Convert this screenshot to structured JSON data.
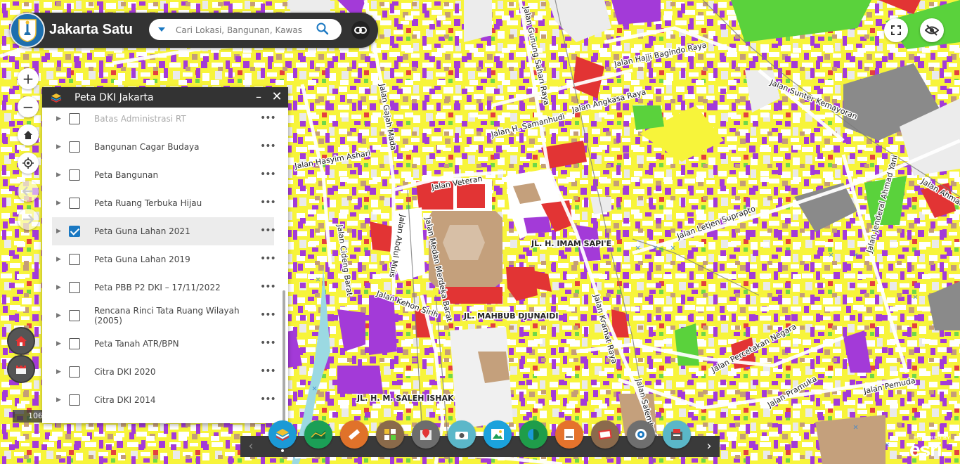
{
  "app": {
    "title": "Jakarta Satu",
    "search_placeholder": "Cari Lokasi, Bangunan, Kawas"
  },
  "map": {
    "street_labels": [
      "Jalan Gajah Mada",
      "Jalan Gunung Sahari Raya",
      "Jalan Hajji Bagindo Raya",
      "Jalan Angkasa Raya",
      "Jalan Sunter Kemayoran",
      "Jalan H. Samanhudi",
      "Jalan Veteran",
      "Jalan Hasyim Ashari",
      "Jalan Medan Merdeka Barat",
      "Jalan Abdul Muis",
      "Jalan Cideng Barat",
      "JL. H. IMAM SAPI'E",
      "Jalan Letjen Suprapto",
      "Jalan Kehon Sirih",
      "JL. MAHBUB DJUNAIDI",
      "JL. H. M. SALEH ISHAK",
      "Jalan Percetakan Negara",
      "Jalan Pramuka",
      "Jalan Pemuda",
      "Jalan Jenderal Ahmad Yani",
      "Jalan Salemba Raya",
      "Jalan Kramat Raya",
      "Jalan Ahmad Yani"
    ]
  },
  "map_controls": {
    "zoom_in": "+",
    "zoom_out": "−",
    "scale_label": "106"
  },
  "layer_panel": {
    "title": "Peta DKI Jakarta",
    "minimize": "–",
    "close": "✕",
    "layers": [
      {
        "name": "Batas Administrasi RT",
        "checked": false
      },
      {
        "name": "Bangunan Cagar Budaya",
        "checked": false
      },
      {
        "name": "Peta Bangunan",
        "checked": false
      },
      {
        "name": "Peta Ruang Terbuka Hijau",
        "checked": false
      },
      {
        "name": "Peta Guna Lahan 2021",
        "checked": true
      },
      {
        "name": "Peta Guna Lahan 2019",
        "checked": false
      },
      {
        "name": "Peta PBB P2 DKI – 17/11/2022",
        "checked": false
      },
      {
        "name": "Rencana Rinci Tata Ruang Wilayah (2005)",
        "checked": false
      },
      {
        "name": "Peta Tanah ATR/BPN",
        "checked": false
      },
      {
        "name": "Citra DKI 2020",
        "checked": false
      },
      {
        "name": "Citra DKI 2014",
        "checked": false
      }
    ],
    "more_symbol": "•••"
  },
  "toolbar": {
    "tools": [
      {
        "icon": "layers-icon",
        "color": "#1b9ad6"
      },
      {
        "icon": "basemap-icon",
        "color": "#1b9f56"
      },
      {
        "icon": "measure-icon",
        "color": "#e0722a"
      },
      {
        "icon": "grid-icon",
        "color": "#8a6a4a"
      },
      {
        "icon": "map-pin-icon",
        "color": "#6d6d6d"
      },
      {
        "icon": "camera-icon",
        "color": "#5bb7c9"
      },
      {
        "icon": "picture-icon",
        "color": "#1ba2dc"
      },
      {
        "icon": "swipe-icon",
        "color": "#1f9d4a"
      },
      {
        "icon": "print-icon",
        "color": "#e5732c"
      },
      {
        "icon": "gallery-icon",
        "color": "#8b6a4c"
      },
      {
        "icon": "compass-icon",
        "color": "#6f6f6f"
      },
      {
        "icon": "report-icon",
        "color": "#5ab7c8"
      }
    ],
    "prev": "‹",
    "next": "›"
  },
  "attribution": {
    "powered_by": "POWERED BY",
    "brand": "esri"
  },
  "colors": {
    "header_bg": "#333333",
    "accent": "#1a78c2",
    "residential": "#f5f23a",
    "commercial": "#a23ad6",
    "government": "#e23434",
    "public": "#c4a07c",
    "green": "#5ad23c"
  }
}
